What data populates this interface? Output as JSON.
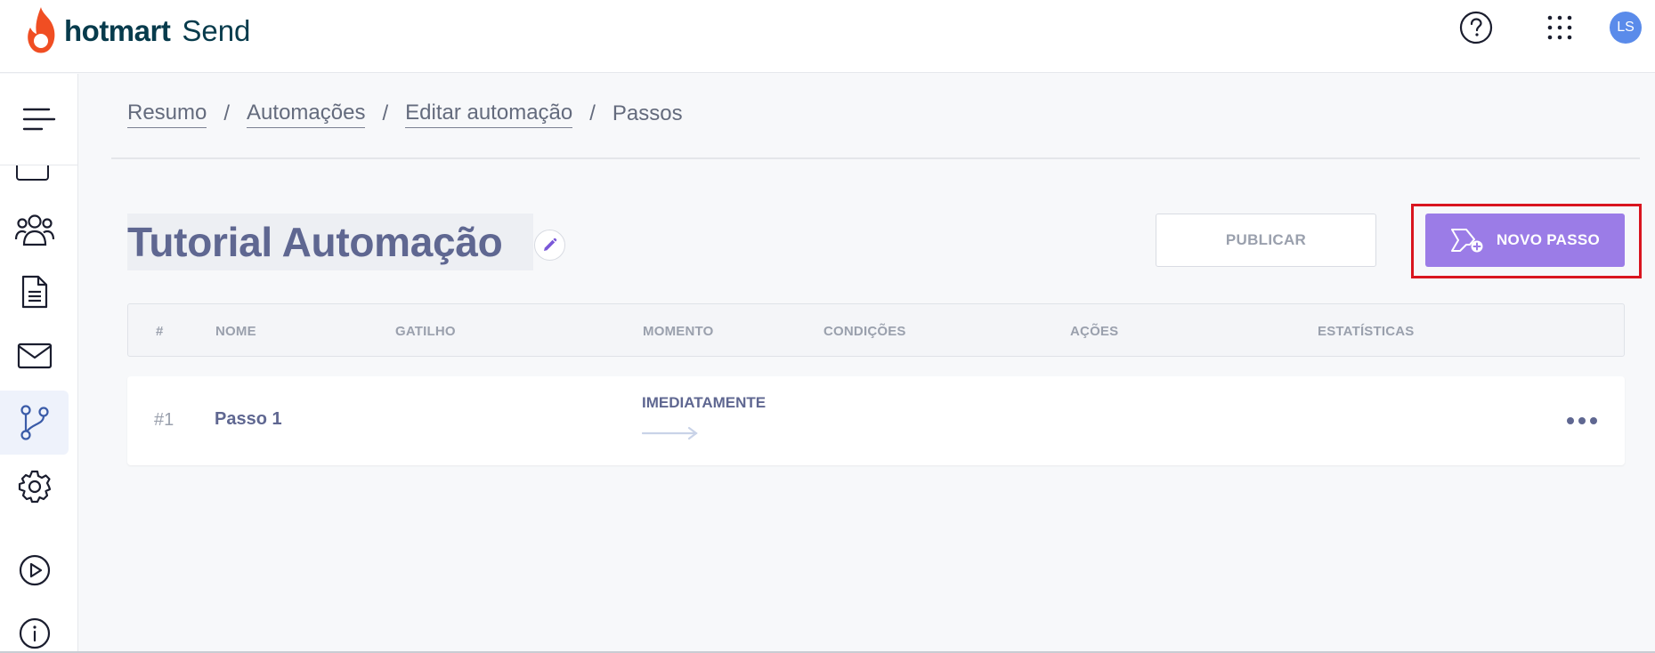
{
  "brand": {
    "name": "hotmart",
    "product": "Send",
    "flame_color": "#f04e23",
    "text_color": "#073b4c"
  },
  "header": {
    "help_icon": "question-circle-icon",
    "apps_icon": "grid-dots-icon",
    "avatar_initials": "LS",
    "avatar_color": "#5a8bea"
  },
  "sidebar": {
    "toggle_icon": "menu-hamburger-icon",
    "items": [
      {
        "icon": "calendar-icon",
        "active": false
      },
      {
        "icon": "users-icon",
        "active": false
      },
      {
        "icon": "document-icon",
        "active": false
      },
      {
        "icon": "mail-icon",
        "active": false
      },
      {
        "icon": "git-branch-icon",
        "active": true
      },
      {
        "icon": "gear-icon",
        "active": false
      },
      {
        "icon": "play-circle-icon",
        "active": false
      },
      {
        "icon": "info-circle-icon",
        "active": false
      }
    ]
  },
  "breadcrumb": {
    "items": [
      "Resumo",
      "Automações",
      "Editar automação"
    ],
    "separator": "/",
    "current": "Passos"
  },
  "page": {
    "title": "Tutorial Automação",
    "edit_icon": "pencil-icon"
  },
  "actions": {
    "publish_label": "PUBLICAR",
    "new_step_label": "NOVO PASSO",
    "new_step_icon": "add-step-icon",
    "accent_color": "#9b7ce7",
    "highlight_color": "#d9151f"
  },
  "table": {
    "columns": [
      "#",
      "NOME",
      "GATILHO",
      "MOMENTO",
      "CONDIÇÕES",
      "AÇÕES",
      "ESTATÍSTICAS"
    ],
    "rows": [
      {
        "number": "#1",
        "name": "Passo 1",
        "trigger": "",
        "moment": "IMEDIATAMENTE",
        "conditions": "",
        "actions": "",
        "stats": ""
      }
    ],
    "row_menu_icon": "more-horizontal-icon"
  }
}
